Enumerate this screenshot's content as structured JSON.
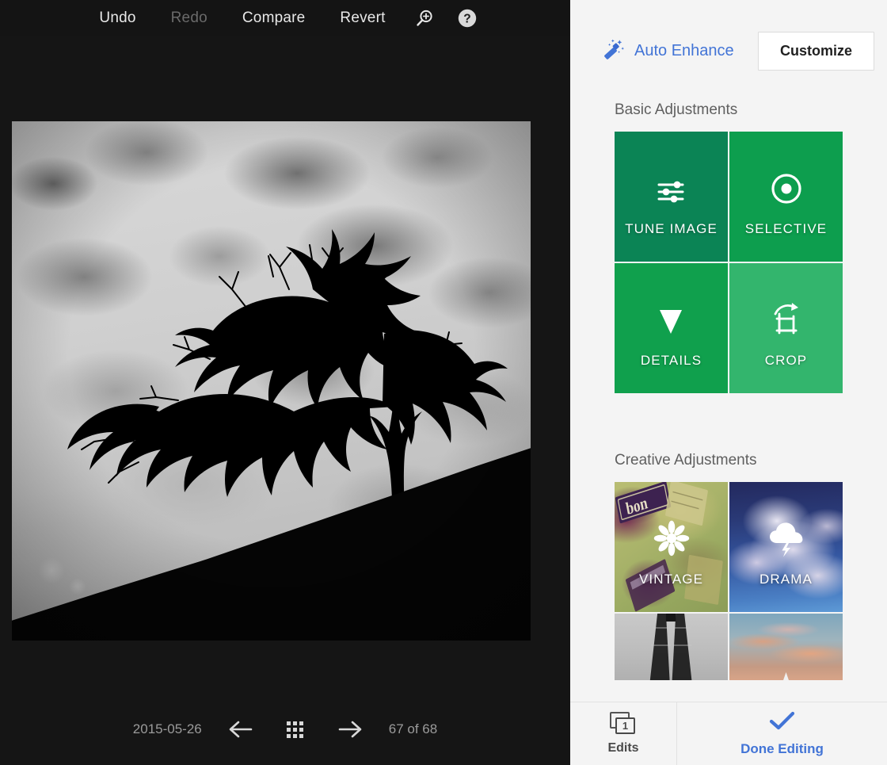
{
  "toolbar": {
    "undo": "Undo",
    "redo": "Redo",
    "compare": "Compare",
    "revert": "Revert",
    "zoom_icon": "zoom-in-icon",
    "help_icon": "help-icon"
  },
  "viewer": {
    "photo_alt": "black-and-white silhouette of a windswept tree on a hillside",
    "date": "2015-05-26",
    "prev_icon": "arrow-left-icon",
    "grid_icon": "grid-view-icon",
    "next_icon": "arrow-right-icon",
    "counter": "67 of 68"
  },
  "panel": {
    "auto_enhance": "Auto Enhance",
    "auto_enhance_icon": "magic-wand-icon",
    "customize": "Customize",
    "basic_title": "Basic Adjustments",
    "creative_title": "Creative Adjustments",
    "basic_tiles": [
      {
        "label": "TUNE IMAGE",
        "icon": "sliders-icon",
        "color": "#0b8455"
      },
      {
        "label": "SELECTIVE",
        "icon": "target-dot-icon",
        "color": "#0d9e4e"
      },
      {
        "label": "DETAILS",
        "icon": "triangle-down-icon",
        "color": "#10a04d"
      },
      {
        "label": "CROP",
        "icon": "crop-rotate-icon",
        "color": "#33b56d"
      }
    ],
    "creative_tiles": [
      {
        "label": "VINTAGE",
        "icon": "flower-icon"
      },
      {
        "label": "DRAMA",
        "icon": "storm-cloud-icon"
      },
      {
        "label": "",
        "icon": ""
      },
      {
        "label": "",
        "icon": ""
      }
    ]
  },
  "bottombar": {
    "edits_label": "Edits",
    "edits_count": "1",
    "edits_icon": "layers-icon",
    "done_label": "Done Editing",
    "done_icon": "checkmark-icon"
  },
  "colors": {
    "accent_blue": "#4274d6",
    "panel_bg": "#f4f4f4",
    "viewer_bg": "#151515"
  }
}
